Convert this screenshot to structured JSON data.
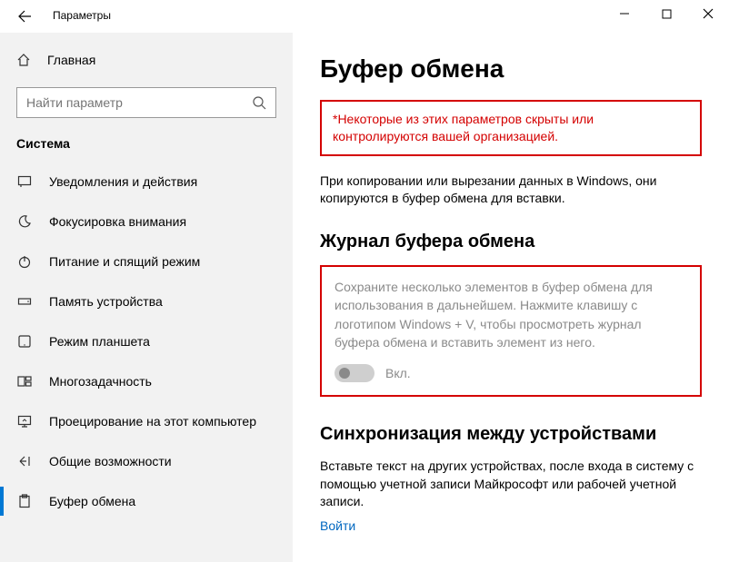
{
  "window": {
    "title": "Параметры"
  },
  "sidebar": {
    "home_label": "Главная",
    "search_placeholder": "Найти параметр",
    "group_label": "Система",
    "items": [
      {
        "label": "Уведомления и действия"
      },
      {
        "label": "Фокусировка внимания"
      },
      {
        "label": "Питание и спящий режим"
      },
      {
        "label": "Память устройства"
      },
      {
        "label": "Режим планшета"
      },
      {
        "label": "Многозадачность"
      },
      {
        "label": "Проецирование на этот компьютер"
      },
      {
        "label": "Общие возможности"
      },
      {
        "label": "Буфер обмена"
      }
    ]
  },
  "content": {
    "page_title": "Буфер обмена",
    "org_notice": "*Некоторые из этих параметров скрыты или контролируются вашей организацией.",
    "intro": "При копировании или вырезании данных в Windows, они копируются в буфер обмена для вставки.",
    "history": {
      "heading": "Журнал буфера обмена",
      "desc": "Сохраните несколько элементов в буфер обмена для использования в дальнейшем. Нажмите клавишу с логотипом Windows + V, чтобы просмотреть журнал буфера обмена и вставить элемент из него.",
      "toggle_label": "Вкл."
    },
    "sync": {
      "heading": "Синхронизация между устройствами",
      "desc": "Вставьте текст на других устройствах, после входа в систему с помощью учетной записи Майкрософт или рабочей учетной записи.",
      "link": "Войти"
    }
  }
}
